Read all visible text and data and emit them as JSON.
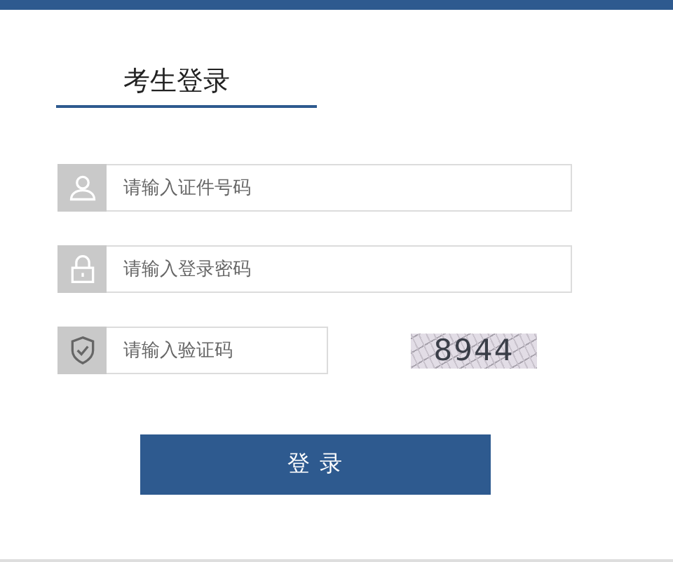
{
  "title": "考生登录",
  "fields": [
    {
      "kind": "user",
      "placeholder": "请输入证件号码"
    },
    {
      "kind": "lock",
      "placeholder": "请输入登录密码"
    },
    {
      "kind": "shield",
      "placeholder": "请输入验证码",
      "captcha": "8944"
    }
  ],
  "button": "登 录"
}
